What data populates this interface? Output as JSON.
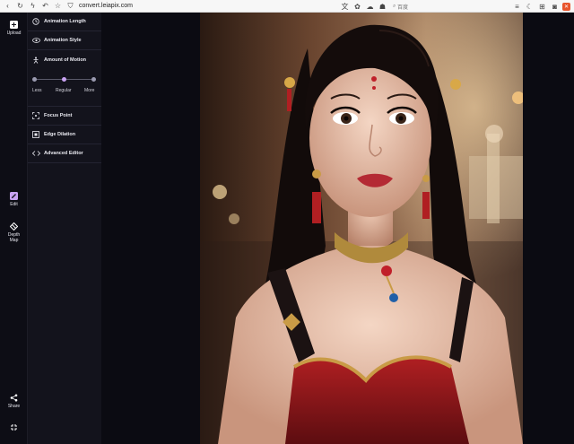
{
  "browser": {
    "url": "convert.leiapix.com",
    "search_placeholder": "百度"
  },
  "rail": {
    "upload_label": "Upload",
    "edit_label": "Edit",
    "depth_label_1": "Depth",
    "depth_label_2": "Map",
    "share_label": "Share"
  },
  "panel": {
    "animation_length": "Animation Length",
    "animation_style": "Animation Style",
    "amount_of_motion": "Amount of Motion",
    "motion_levels": [
      "Less",
      "Regular",
      "More"
    ],
    "motion_value": "Regular",
    "focus_point": "Focus Point",
    "edge_dilation": "Edge Dilation",
    "advanced_editor": "Advanced Editor"
  },
  "colors": {
    "accent": "#c9a3f3",
    "panel_bg": "#13131c",
    "rail_bg": "#0d0d15"
  }
}
